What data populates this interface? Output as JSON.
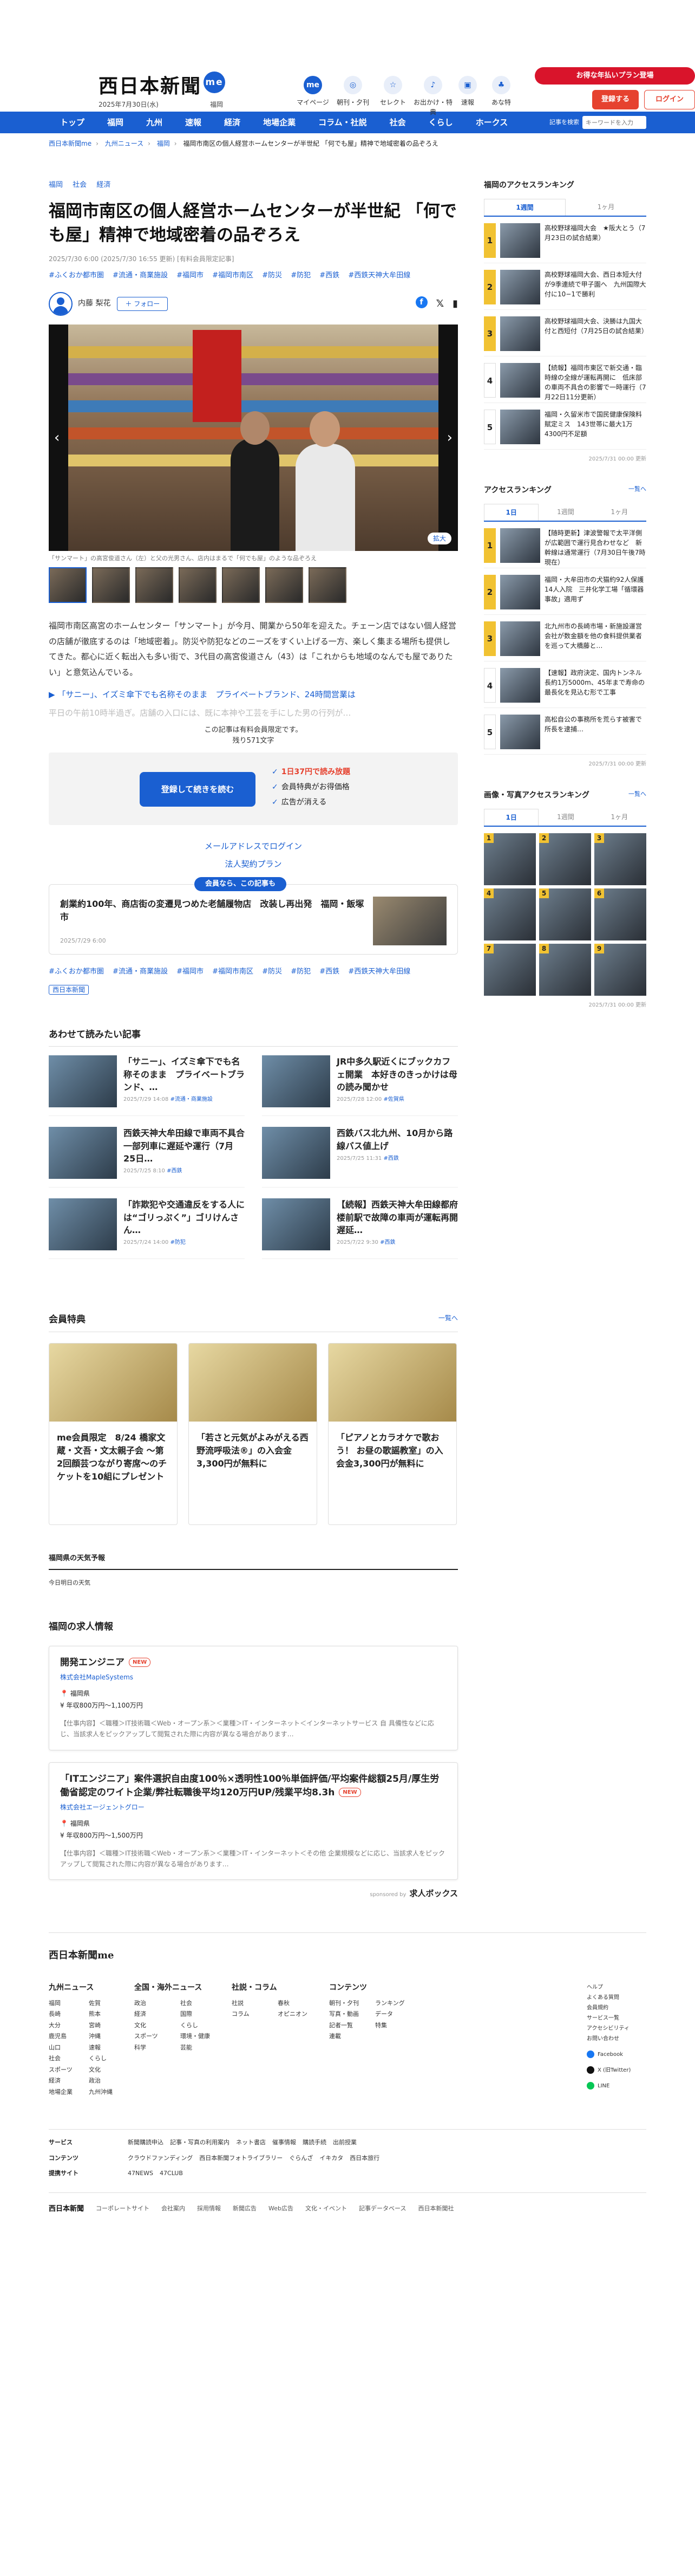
{
  "header": {
    "logo": "西日本新聞",
    "logo_badge": "me",
    "date": "2025年7月30日(水)",
    "weather": "福岡",
    "services": [
      {
        "label": "マイページ",
        "icon": "me"
      },
      {
        "label": "朝刊・夕刊",
        "icon": "◎"
      },
      {
        "label": "セレクト",
        "icon": "☆"
      },
      {
        "label": "お出かけ・特典",
        "icon": "♪"
      },
      {
        "label": "速報",
        "icon": "▣"
      },
      {
        "label": "あな特",
        "icon": "♣"
      }
    ],
    "campaign": "お得な年払いプラン登場",
    "register": "登録する",
    "login": "ログイン"
  },
  "nav": {
    "items": [
      "トップ",
      "福岡",
      "九州",
      "速報",
      "経済",
      "地場企業",
      "コラム・社説",
      "社会",
      "くらし",
      "ホークス"
    ],
    "search_label": "記事を検索",
    "search_placeholder": "キーワードを入力"
  },
  "breadcrumb": [
    "西日本新聞me",
    "九州ニュース",
    "福岡",
    "福岡市南区の個人経営ホームセンターが半世紀 「何でも屋」精神で地域密着の品ぞろえ"
  ],
  "article": {
    "categories": [
      "福岡",
      "社会",
      "経済"
    ],
    "title": "福岡市南区の個人経営ホームセンターが半世紀 「何でも屋」精神で地域密着の品ぞろえ",
    "published": "2025/7/30 6:00 (2025/7/30 16:55 更新) [有料会員限定記事]",
    "tags": [
      "#ふくおか都市圏",
      "#流通・商業施設",
      "#福岡市",
      "#福岡市南区",
      "#防災",
      "#防犯",
      "#西鉄",
      "#西鉄天神大牟田線"
    ],
    "author": "内藤 梨花",
    "follow": "＋ フォロー",
    "zoom": "拡大",
    "caption": "「サンマート」の高宮俊道さん（左）と父の光男さん、店内はまるで「何でも屋」のような品ぞろえ",
    "paragraphs": [
      "福岡市南区高宮のホームセンター「サンマート」が今月、開業から50年を迎えた。チェーン店ではない個人経営の店舗が徹底するのは「地域密着」。防災や防犯などのニーズをすくい上げる一方、楽しく集まる場所も提供してきた。都心に近く転出入も多い街で、3代目の高宮俊道さん（43）は「これからも地域のなんでも屋でありたい」と意気込んでいる。"
    ],
    "related": "「サニー」、イズミ傘下でも名称そのまま　プライベートブランド、24時間営業は",
    "fade": "平日の午前10時半過ぎ。店舗の入口には、既に本神や工芸を手にした男の行列が…",
    "paywall_note": "この記事は有料会員限定です。",
    "remaining": "残り571文字",
    "pay_button": "登録して続きを読む",
    "benefits": [
      "1日37円で読み放題",
      "会員特典がお得価格",
      "広告が消える"
    ],
    "mail_login": "メールアドレスでログイン",
    "corporate": "法人契約プラン",
    "member_tag": "会員なら、この記事も",
    "member_title": "創業約100年、商店街の変遷見つめた老舗履物店　改装し再出発　福岡・飯塚市",
    "member_date": "2025/7/29 6:00",
    "paper_badge": "西日本新聞"
  },
  "also_read": {
    "title": "あわせて読みたい記事",
    "items": [
      {
        "title": "「サニー」、イズミ傘下でも名称そのまま　プライベートブランド、…",
        "date": "2025/7/29 14:08",
        "tag": "#流通・商業施設"
      },
      {
        "title": "JR中多久駅近くにブックカフェ開業　本好きのきっかけは母の読み聞かせ",
        "date": "2025/7/28 12:00",
        "tag": "#佐賀県"
      },
      {
        "title": "西鉄天神大牟田線で車両不具合　一部列車に遅延や運行（7月25日…",
        "date": "2025/7/25 8:10",
        "tag": "#西鉄"
      },
      {
        "title": "西鉄バス北九州、10月から路線バス値上げ",
        "date": "2025/7/25 11:31",
        "tag": "#西鉄"
      },
      {
        "title": "「詐欺犯や交通違反をする人には“ゴリっぷく”」ゴリけんさん…",
        "date": "2025/7/24 14:00",
        "tag": "#防犯"
      },
      {
        "title": "【続報】西鉄天神大牟田線都府楼前駅で故障の車両が運転再開　遅延…",
        "date": "2025/7/22 9:30",
        "tag": "#西鉄"
      }
    ]
  },
  "benefits_section": {
    "title": "会員特典",
    "more": "一覧へ",
    "items": [
      "me会員限定　8/24 橋家文蔵・文吾・文太親子会 〜第2回顔芸つながり寄席〜のチケットを10組にプレゼント",
      "「若さと元気がよみがえる西野流呼吸法®」の入会金3,300円が無料に",
      "「ピアノとカラオケで歌おう！ お昼の歌謡教室」の入会金3,300円が無料に"
    ]
  },
  "weather_section": {
    "title": "福岡県の天気予報",
    "sub": "今日明日の天気"
  },
  "jobs": {
    "title": "福岡の求人情報",
    "new": "NEW",
    "items": [
      {
        "title": "開発エンジニア",
        "company": "株式会社MapleSystems",
        "location": "福岡県",
        "pay": "年収800万円〜1,100万円",
        "desc": "【仕事内容】＜職種＞IT技術職＜Web・オープン系＞＜業種＞IT・インターネット＜インターネットサービス 自 具備性などに応じ、当該求人をピックアップして閲覧された際に内容が異なる場合があります…"
      },
      {
        "title": "「ITエンジニア」案件選択自由度100％×透明性100％単価評価/平均案件総額25月/厚生労働省認定のワイト企業/弊社転職後平均120万円UP/残業平均8.3h",
        "company": "株式会社エージェントグロー",
        "location": "福岡県",
        "pay": "年収800万円〜1,500万円",
        "desc": "【仕事内容】＜職種＞IT技術職＜Web・オープン系＞＜業種＞IT・インターネット＜その他 企業規模などに応じ、当該求人をピックアップして閲覧された際に内容が異なる場合があります…"
      }
    ],
    "sponsored": "sponsored by",
    "sponsor": "求人ボックス"
  },
  "sidebar": {
    "ranking_title": "福岡のアクセスランキング",
    "ranking_tabs": [
      "1週間",
      "1ヶ月"
    ],
    "ranking": [
      "高校野球福岡大会　★阪大とう（7月23日の試合結果）",
      "高校野球福岡大会、西日本短大付が9季連続で甲子園へ　九州国際大付に10−1で勝利",
      "高校野球福岡大会、決勝は九国大付と西短付（7月25日の試合結果）",
      "【続報】福岡市東区で新交通・臨時線の全線が運転再開に　低床部の車両不具合の影響で一時運行（7月22日11分更新）",
      "福岡・久留米市で国民健康保険料賦定ミス　143世帯に最大1万4300円不足額"
    ],
    "ranking_updated": "2025/7/31 00:00 更新",
    "access_title": "アクセスランキング",
    "access_more": "一覧へ",
    "access_tabs": [
      "1日",
      "1週間",
      "1ヶ月"
    ],
    "access": [
      "【随時更新】津波警報で太平洋側が広範囲で運行見合わせなど　新幹線は通常運行（7月30日午後7時現在）",
      "福岡・大牟田市の犬猫約92人保護14人入院　三井化学工場「循環器事故」適用ず",
      "北九州市の長崎市場・新施設運営会社が数金額を他の食料提供業者を巡って大橋藤と…",
      "【速報】政府決定、国内トンネル長約1万5000m、45年まで寿命の最長化を見込む形で工事",
      "高松自公の事務所を荒らす被害で所長を逮捕…"
    ],
    "access_updated": "2025/7/31 00:00 更新",
    "gallery_title": "画像・写真アクセスランキング",
    "gallery_more": "一覧へ",
    "gallery_tabs": [
      "1日",
      "1週間",
      "1ヶ月"
    ],
    "gallery_numbers": [
      "1",
      "2",
      "3",
      "4",
      "5",
      "6",
      "7",
      "8",
      "9"
    ],
    "gallery_updated": "2025/7/31 00:00 更新"
  },
  "footer": {
    "logo": "西日本新聞me",
    "cols": [
      {
        "title": "九州ニュース",
        "items": [
          "福岡",
          "佐賀",
          "長崎",
          "熊本",
          "大分",
          "宮崎",
          "鹿児島",
          "沖縄",
          "山口",
          "速報",
          "社会",
          "くらし",
          "スポーツ",
          "文化",
          "経済",
          "政治",
          "地場企業",
          "九州沖縄"
        ]
      },
      {
        "title": "全国・海外ニュース",
        "items": [
          "政治",
          "社会",
          "経済",
          "国際",
          "文化",
          "くらし",
          "スポーツ",
          "環境・健康",
          "科学",
          "芸能"
        ]
      },
      {
        "title": "社説・コラム",
        "items": [
          "社説",
          "春秋",
          "コラム",
          "オピニオン"
        ]
      },
      {
        "title": "コンテンツ",
        "items": [
          "朝刊・夕刊",
          "ランキング",
          "写真・動画",
          "データ",
          "記者一覧",
          "特集",
          "連載"
        ]
      }
    ],
    "side": [
      "ヘルプ",
      "よくある質問",
      "会員規約",
      "サービス一覧",
      "アクセシビリティ",
      "お問い合わせ"
    ],
    "sns": [
      "Facebook",
      "X (旧Twitter)",
      "LINE"
    ],
    "rows": [
      {
        "label": "サービス",
        "items": [
          "新聞購読申込",
          "記事・写真の利用案内",
          "ネット書店",
          "催事情報",
          "購読手続",
          "出前授業"
        ]
      },
      {
        "label": "コンテンツ",
        "items": [
          "クラウドファンディング",
          "西日本新聞フォトライブラリー",
          "ぐらんざ",
          "イキカタ",
          "西日本旅行"
        ]
      },
      {
        "label": "提携サイト",
        "items": [
          "47NEWS",
          "47CLUB"
        ]
      }
    ],
    "bottom_logo": "西日本新聞",
    "bottom": [
      "コーポレートサイト",
      "会社案内",
      "採用情報",
      "新聞広告",
      "Web広告",
      "文化・イベント",
      "記事データベース",
      "西日本新聞社"
    ]
  }
}
